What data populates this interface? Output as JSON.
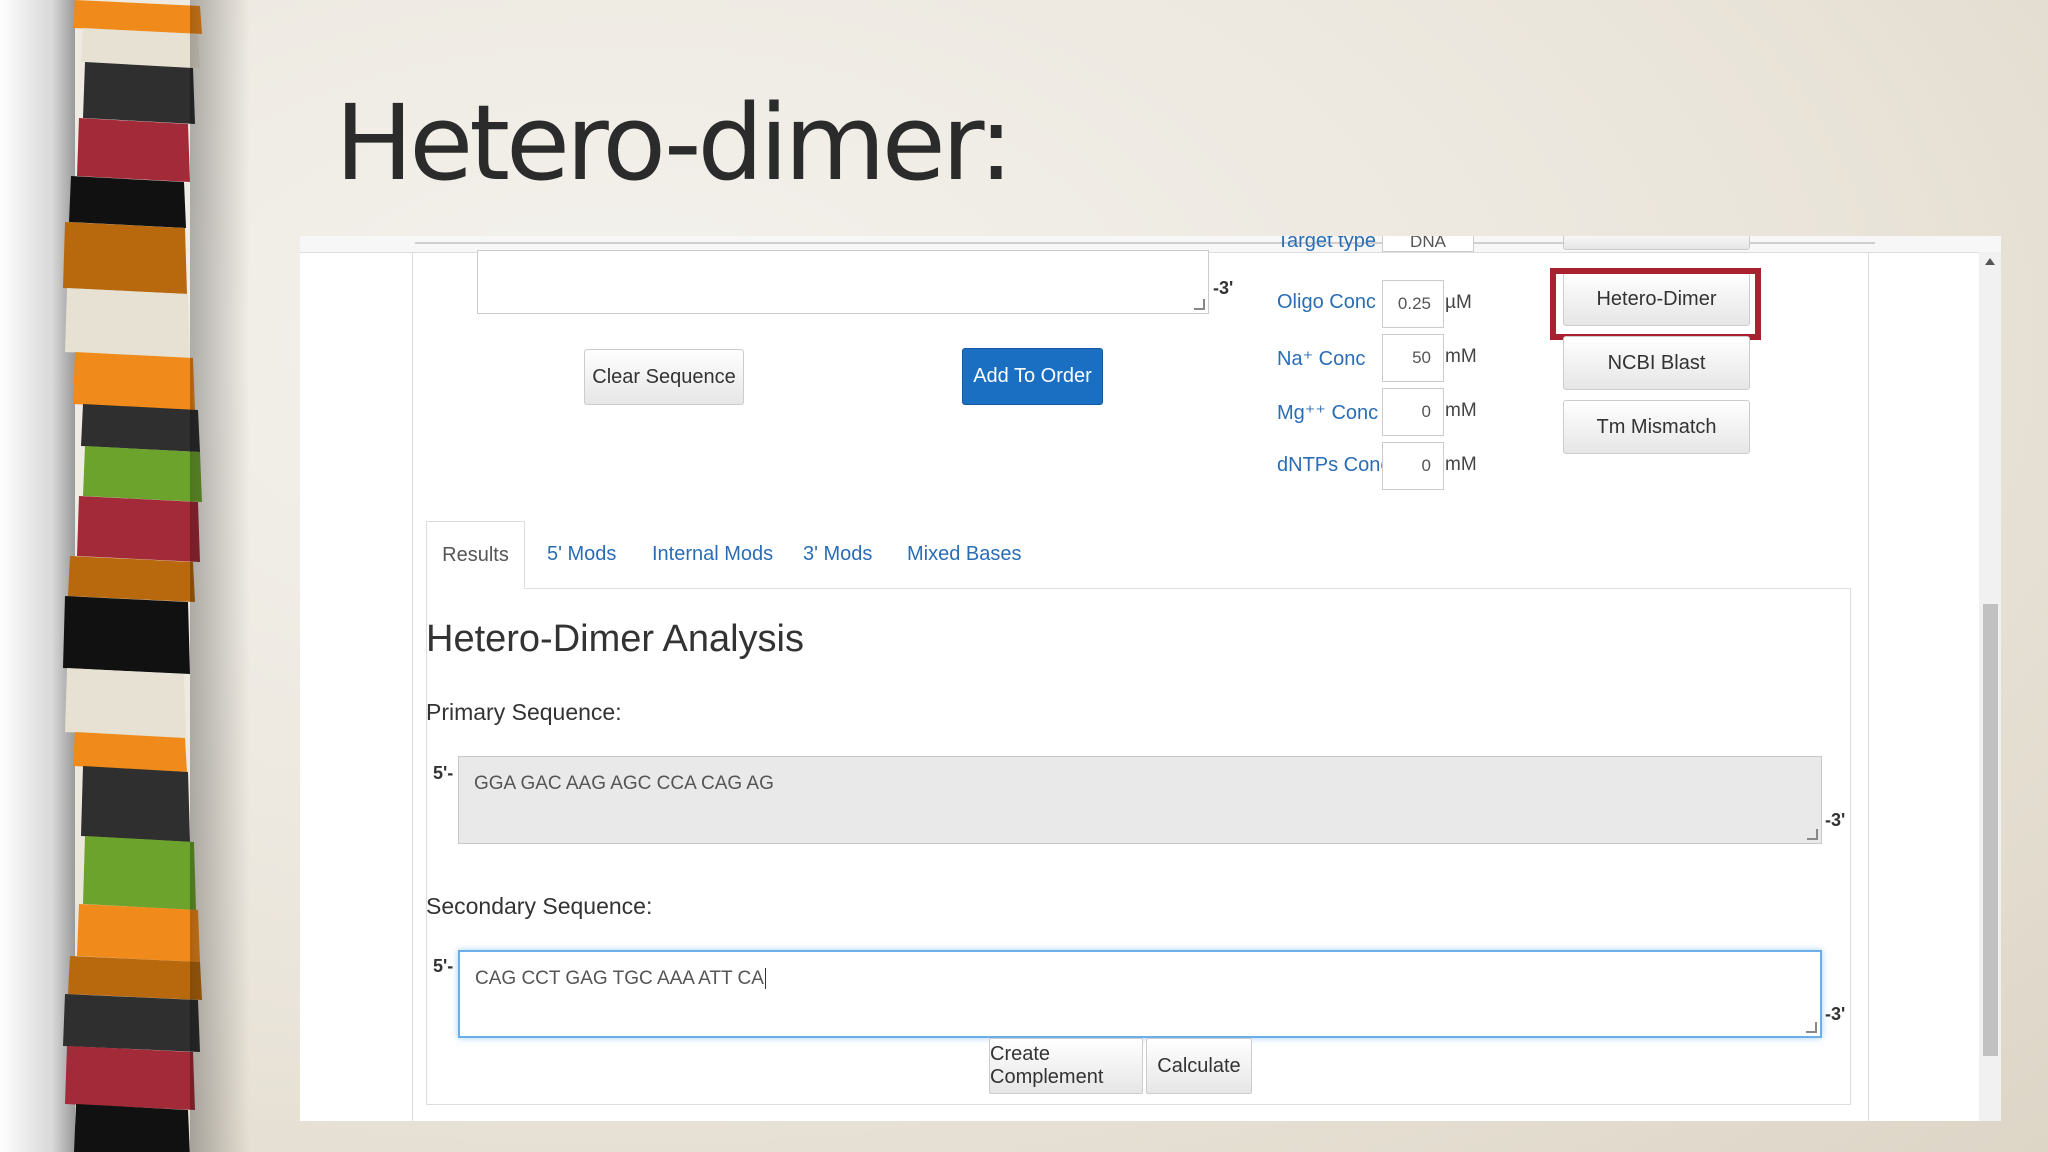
{
  "slide": {
    "title": "Hetero-dimer:"
  },
  "form": {
    "top_sequence_suffix": "-3'",
    "clear_label": "Clear Sequence",
    "add_order_label": "Add To Order"
  },
  "params": {
    "target_type_label": "Target type",
    "target_type_value": "DNA",
    "oligo_conc": {
      "label": "Oligo Conc",
      "value": "0.25",
      "unit": "µM"
    },
    "na_conc": {
      "label": "Na⁺ Conc",
      "value": "50",
      "unit": "mM"
    },
    "mg_conc": {
      "label": "Mg⁺⁺ Conc",
      "value": "0",
      "unit": "mM"
    },
    "dntps_conc": {
      "label": "dNTPs Conc",
      "value": "0",
      "unit": "mM"
    }
  },
  "side_buttons": {
    "hetero_dimer": "Hetero-Dimer",
    "ncbi_blast": "NCBI Blast",
    "tm_mismatch": "Tm Mismatch"
  },
  "tabs": [
    "Results",
    "5' Mods",
    "Internal Mods",
    "3' Mods",
    "Mixed Bases"
  ],
  "analysis": {
    "heading": "Hetero-Dimer Analysis",
    "primary_label": "Primary Sequence:",
    "primary_value": "GGA GAC AAG AGC CCA CAG AG",
    "secondary_label": "Secondary Sequence:",
    "secondary_value": "CAG CCT GAG TGC AAA ATT CA",
    "five_prime": "5'-",
    "three_prime": "-3'",
    "create_complement_label": "Create Complement",
    "calculate_label": "Calculate"
  },
  "colors": {
    "highlight": "#a8212f",
    "primary_button": "#1a6fc2",
    "link": "#2a6db4"
  }
}
